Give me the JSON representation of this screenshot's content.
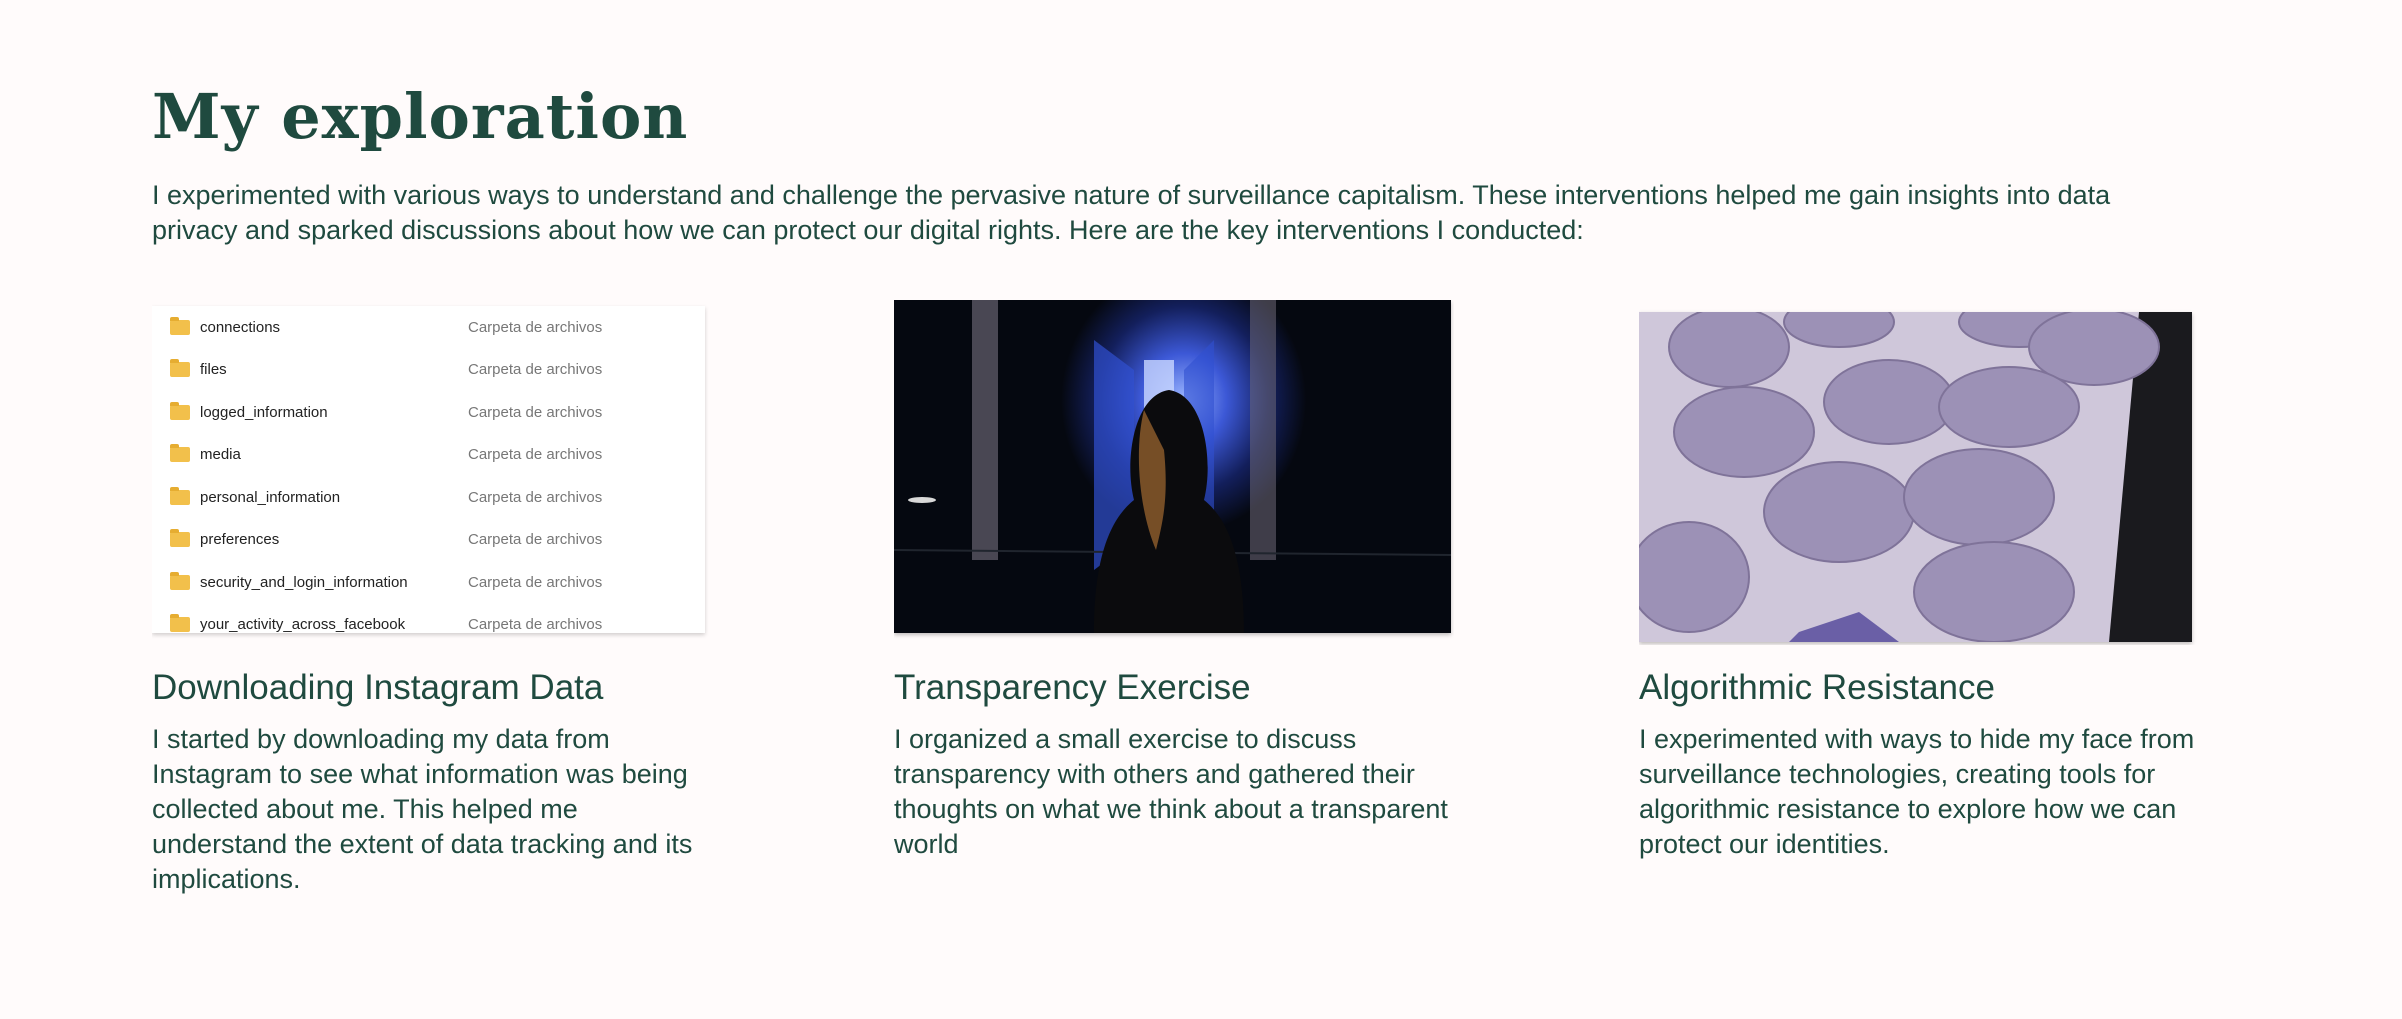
{
  "page": {
    "title": "My exploration",
    "intro": "I experimented with various ways to understand and challenge the pervasive nature of surveillance capitalism. These interventions helped me gain insights into data privacy and sparked discussions about how we can protect our digital rights. Here are the key interventions I conducted:"
  },
  "cards": [
    {
      "title": "Downloading Instagram Data",
      "description": "I started by downloading my data from Instagram to see what information was being collected about me. This helped me understand the extent of data tracking and its implications.",
      "files": [
        {
          "name": "connections",
          "type": "Carpeta de archivos",
          "icon": "folder-icon"
        },
        {
          "name": "files",
          "type": "Carpeta de archivos",
          "icon": "folder-icon"
        },
        {
          "name": "logged_information",
          "type": "Carpeta de archivos",
          "icon": "folder-icon"
        },
        {
          "name": "media",
          "type": "Carpeta de archivos",
          "icon": "folder-icon"
        },
        {
          "name": "personal_information",
          "type": "Carpeta de archivos",
          "icon": "folder-icon"
        },
        {
          "name": "preferences",
          "type": "Carpeta de archivos",
          "icon": "folder-icon"
        },
        {
          "name": "security_and_login_information",
          "type": "Carpeta de archivos",
          "icon": "folder-icon"
        },
        {
          "name": "your_activity_across_facebook",
          "type": "Carpeta de archivos",
          "icon": "folder-icon"
        }
      ]
    },
    {
      "title": "Transparency Exercise",
      "description": "I organized a small exercise to discuss transparency with others and gathered their thoughts on what we think about a transparent world"
    },
    {
      "title": "Algorithmic Resistance",
      "description": "I experimented with ways to hide my face from surveillance technologies, creating tools for algorithmic resistance to explore how we can protect our identities."
    }
  ],
  "colors": {
    "background": "#fffbfb",
    "text": "#1f4a3f",
    "folder": "#f2c04b"
  }
}
